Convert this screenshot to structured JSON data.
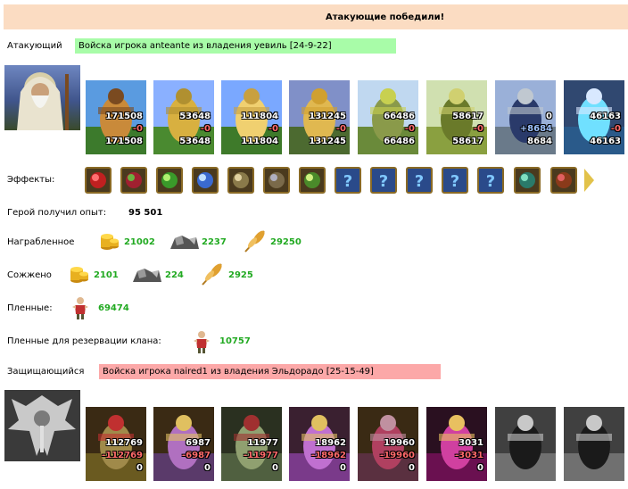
{
  "header": {
    "title": "Атакующие победили!"
  },
  "attacker": {
    "label": "Атакующий",
    "army_text": "Войска игрока anteante из владения уевиль [24-9-22]",
    "units": [
      {
        "top": "171508",
        "mid": "-0",
        "bottom": "171508"
      },
      {
        "top": "53648",
        "mid": "-0",
        "bottom": "53648"
      },
      {
        "top": "111804",
        "mid": "-0",
        "bottom": "111804"
      },
      {
        "top": "131245",
        "mid": "-0",
        "bottom": "131245"
      },
      {
        "top": "66486",
        "mid": "-0",
        "bottom": "66486"
      },
      {
        "top": "58617",
        "mid": "-0",
        "bottom": "58617"
      },
      {
        "top": "0",
        "mid": "+8684",
        "bottom": "8684"
      },
      {
        "top": "46163",
        "mid": "-0",
        "bottom": "46163"
      }
    ]
  },
  "effects": {
    "label": "Эффекты:",
    "icons": [
      "heart-icon",
      "heart-potion-icon",
      "green-flask-icon",
      "frost-star-icon",
      "skull-icon",
      "gray-rune-icon",
      "green-sword-icon",
      "question-icon",
      "question-icon",
      "question-icon",
      "question-icon",
      "question-icon",
      "shield-orb-icon",
      "chest-heart-icon"
    ]
  },
  "experience": {
    "label": "Герой получил опыт:",
    "value": "95 501"
  },
  "loot": {
    "label": "Награбленное",
    "gold": "21002",
    "ore": "2237",
    "grain": "29250"
  },
  "burned": {
    "label": "Сожжено",
    "gold": "2101",
    "ore": "224",
    "grain": "2925"
  },
  "prisoners": {
    "label": "Пленные:",
    "value": "69474"
  },
  "clan_prisoners": {
    "label": "Пленные для резервации клана:",
    "value": "10757"
  },
  "defender": {
    "label": "Защищающийся",
    "army_text": "Войска игрока naired1 из владения Эльдорадо [25-15-49]",
    "units": [
      {
        "top": "112769",
        "mid": "-112769",
        "bottom": "0"
      },
      {
        "top": "6987",
        "mid": "-6987",
        "bottom": "0"
      },
      {
        "top": "11977",
        "mid": "-11977",
        "bottom": "0"
      },
      {
        "top": "18962",
        "mid": "-18962",
        "bottom": "0"
      },
      {
        "top": "19960",
        "mid": "-19960",
        "bottom": "0"
      },
      {
        "top": "3031",
        "mid": "-3031",
        "bottom": "0"
      },
      {
        "top": "",
        "mid": "",
        "bottom": ""
      },
      {
        "top": "",
        "mid": "",
        "bottom": ""
      }
    ]
  },
  "colors": {
    "banner": "#fbdcc2",
    "attacker_bar": "#a8fca8",
    "defender_bar": "#fca8a8",
    "gain": "#22aa22",
    "loss": "#ff6a6a",
    "bonus": "#9fc3ff"
  }
}
